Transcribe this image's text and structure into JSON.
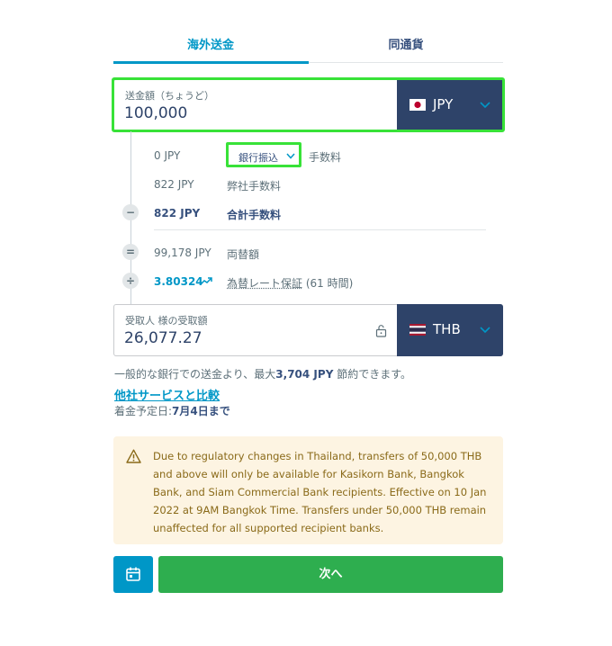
{
  "tabs": [
    {
      "label": "海外送金",
      "active": true
    },
    {
      "label": "同通貨",
      "active": false
    }
  ],
  "send": {
    "label": "送金額（ちょうど）",
    "value": "100,000",
    "currency": "JPY",
    "flag": "japan-flag"
  },
  "fees": {
    "method_fee_amount": "0 JPY",
    "method_label": "銀行振込",
    "method_fee_label": "手数料",
    "our_fee_amount": "822 JPY",
    "our_fee_label": "弊社手数料",
    "total_fee_amount": "822 JPY",
    "total_fee_label": "合計手数料",
    "converted_amount": "99,178 JPY",
    "converted_label": "両替額",
    "rate": "3.80324",
    "rate_label": "為替レート保証",
    "rate_duration": " (61 時間)"
  },
  "symbols": {
    "minus": "−",
    "equals": "=",
    "divide": "÷"
  },
  "receive": {
    "label": "受取人 様の受取額",
    "value": "26,077.27",
    "currency": "THB",
    "flag": "thailand-flag"
  },
  "savings": {
    "prefix": "一般的な銀行での送金より、最大",
    "amount": "3,704 JPY",
    "suffix": " 節約できます。"
  },
  "compare_link": "他社サービスと比較",
  "eta": {
    "prefix": "着金予定日:",
    "date": "7月4日まで"
  },
  "alert": {
    "icon": "warning-icon",
    "message": "Due to regulatory changes in Thailand, transfers of 50,000 THB and above will only be available for Kasikorn Bank, Bangkok Bank, and Siam Commercial Bank recipients. Effective on 10 Jan 2022 at 9AM Bangkok Time. Transfers under 50,000 THB remain unaffected for all supported recipient banks."
  },
  "buttons": {
    "calendar_icon": "calendar-icon",
    "next": "次へ"
  },
  "colors": {
    "brand_navy": "#2e4369",
    "accent_blue": "#0097c7",
    "primary_green": "#2eae4f",
    "highlight_green": "#38e238",
    "alert_bg": "#fdf4e2",
    "alert_text": "#8a6a19"
  }
}
